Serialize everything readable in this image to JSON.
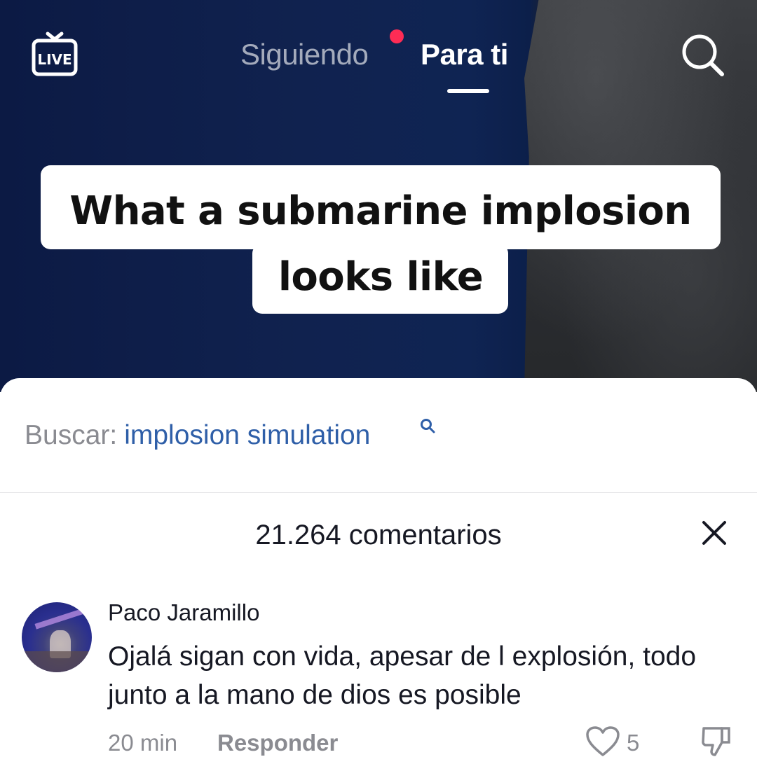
{
  "header": {
    "live_label": "LIVE",
    "tab_following": "Siguiendo",
    "tab_for_you": "Para ti",
    "active_tab": "Para ti",
    "notification_dot": true
  },
  "video": {
    "caption_line1": "What a submarine implosion",
    "caption_line2": "looks like"
  },
  "search_suggestion": {
    "prefix": "Buscar:",
    "term": "implosion simulation"
  },
  "comments_panel": {
    "title": "21.264 comentarios"
  },
  "comments": [
    {
      "author": "Paco Jaramillo",
      "text": "Ojalá sigan con vida, apesar de l explosión, todo junto a la mano de dios es posible",
      "time": "20 min",
      "reply_label": "Responder",
      "likes": "5"
    }
  ],
  "colors": {
    "accent_dot": "#fe2c55",
    "link_blue": "#2f5fa8",
    "muted_text": "#8a8b91",
    "primary_text": "#161823"
  },
  "icons": [
    "live-tv-icon",
    "search-icon",
    "close-icon",
    "heart-icon",
    "dislike-icon"
  ]
}
